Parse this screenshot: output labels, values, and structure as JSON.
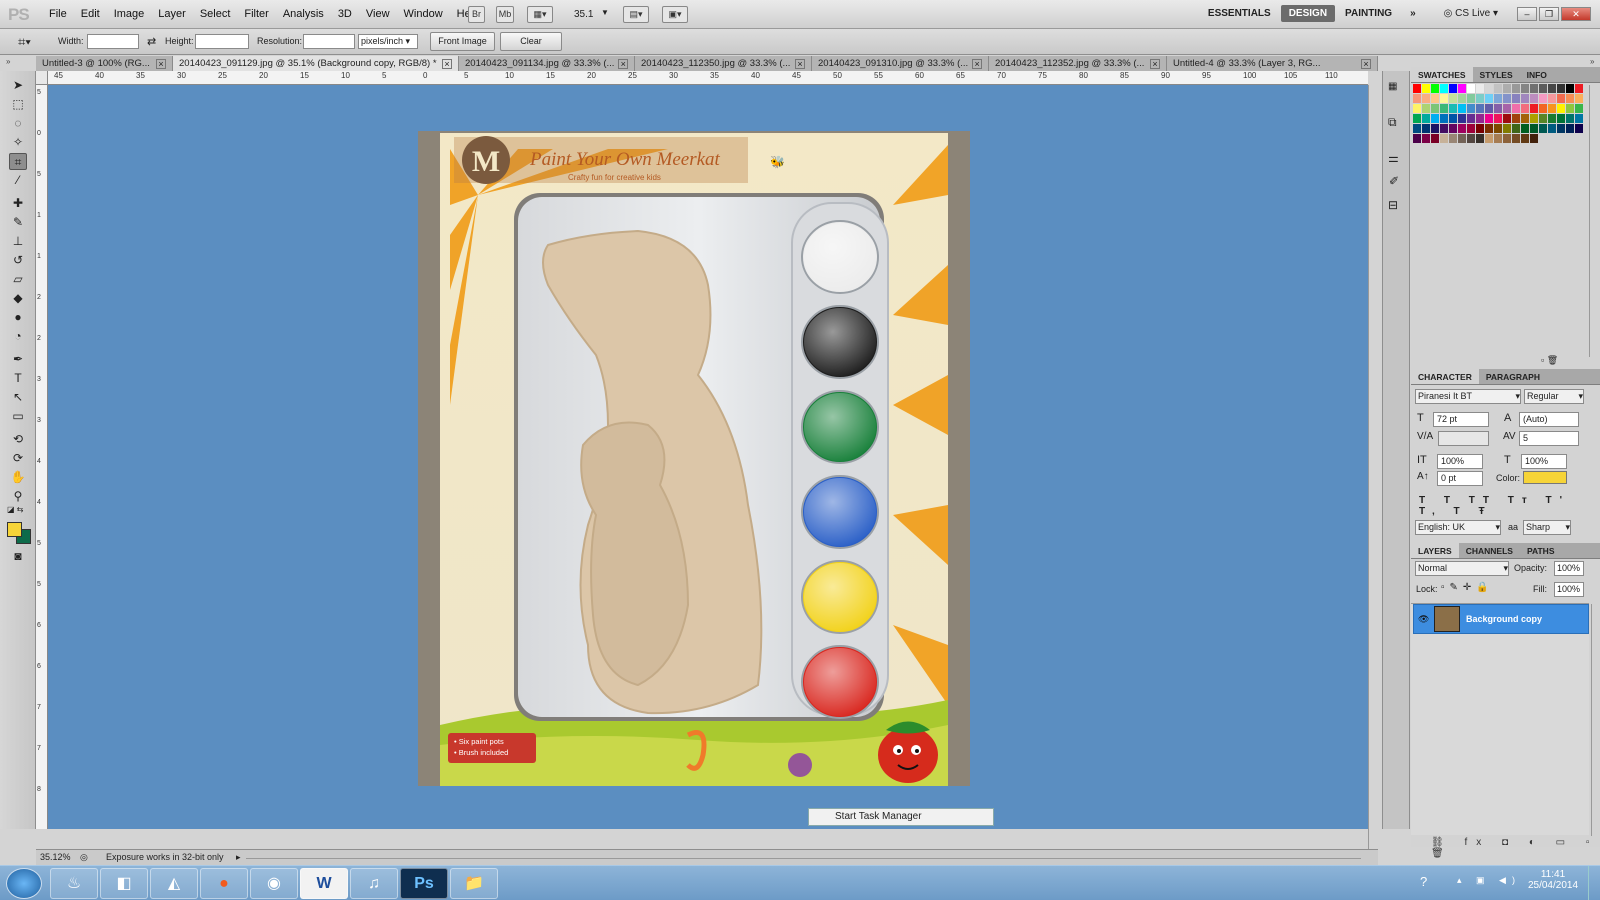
{
  "app": {
    "logo": "PS"
  },
  "menu": [
    "File",
    "Edit",
    "Image",
    "Layer",
    "Select",
    "Filter",
    "Analysis",
    "3D",
    "View",
    "Window",
    "Help"
  ],
  "menubar_icons": {
    "br": "Br",
    "mb": "Mb",
    "zoom": "35.1"
  },
  "workspaces": [
    {
      "label": "ESSENTIALS",
      "active": false
    },
    {
      "label": "DESIGN",
      "active": true
    },
    {
      "label": "PAINTING",
      "active": false
    },
    {
      "label": "»",
      "active": false
    }
  ],
  "cslive": "CS Live",
  "options": {
    "width_label": "Width:",
    "height_label": "Height:",
    "resolution_label": "Resolution:",
    "units": "pixels/inch",
    "front_image": "Front Image",
    "clear": "Clear"
  },
  "tabs": [
    {
      "label": "Untitled-3 @ 100% (RG...",
      "active": false
    },
    {
      "label": "20140423_091129.jpg @ 35.1% (Background copy, RGB/8) *",
      "active": true
    },
    {
      "label": "20140423_091134.jpg @ 33.3% (...",
      "active": false
    },
    {
      "label": "20140423_112350.jpg @ 33.3% (...",
      "active": false
    },
    {
      "label": "20140423_091310.jpg @ 33.3% (...",
      "active": false
    },
    {
      "label": "20140423_112352.jpg @ 33.3% (...",
      "active": false
    },
    {
      "label": "Untitled-4 @ 33.3% (Layer 3, RG...",
      "active": false
    }
  ],
  "hruler": [
    "45",
    "40",
    "35",
    "30",
    "25",
    "20",
    "15",
    "10",
    "5",
    "0",
    "5",
    "10",
    "15",
    "20",
    "25",
    "30",
    "35",
    "40",
    "45",
    "50",
    "55",
    "60",
    "65",
    "70",
    "75",
    "80",
    "85",
    "90",
    "95",
    "100",
    "105",
    "110"
  ],
  "vruler": [
    "5",
    "0",
    "5",
    "1",
    "1",
    "2",
    "2",
    "3",
    "3",
    "4",
    "4",
    "5",
    "5",
    "6",
    "6",
    "7",
    "7",
    "8"
  ],
  "image": {
    "brand_letter": "M",
    "title": "Paint Your Own Meerkat",
    "subtitle": "Crafty fun for creative kids",
    "badge_line1": "• Six paint pots",
    "badge_line2": "• Brush included",
    "pots": [
      "#ececec",
      "#1d1d1d",
      "#18803a",
      "#2a5fc7",
      "#f2d21a",
      "#d9271f"
    ]
  },
  "tooltip": "Start Task Manager",
  "swatches_panel": {
    "tabs": [
      "SWATCHES",
      "STYLES",
      "INFO"
    ]
  },
  "character_panel": {
    "tabs": [
      "CHARACTER",
      "PARAGRAPH"
    ],
    "font": "Piranesi It BT",
    "style": "Regular",
    "size": "72 pt",
    "leading": "(Auto)",
    "kerning": "",
    "tracking": "5",
    "vscale": "100%",
    "hscale": "100%",
    "baseline": "0 pt",
    "color_label": "Color:",
    "color": "#f6d438",
    "language": "English: UK",
    "aa_label": "aa",
    "antialias": "Sharp"
  },
  "layers_panel": {
    "tabs": [
      "LAYERS",
      "CHANNELS",
      "PATHS"
    ],
    "blend": "Normal",
    "opacity_label": "Opacity:",
    "opacity": "100%",
    "lock_label": "Lock:",
    "fill_label": "Fill:",
    "fill": "100%",
    "layers": [
      {
        "name": "Background copy",
        "selected": true
      }
    ]
  },
  "status": {
    "zoom": "35.12%",
    "message": "Exposure works in 32-bit only"
  },
  "taskbar": {
    "time": "11:41",
    "date": "25/04/2014"
  }
}
